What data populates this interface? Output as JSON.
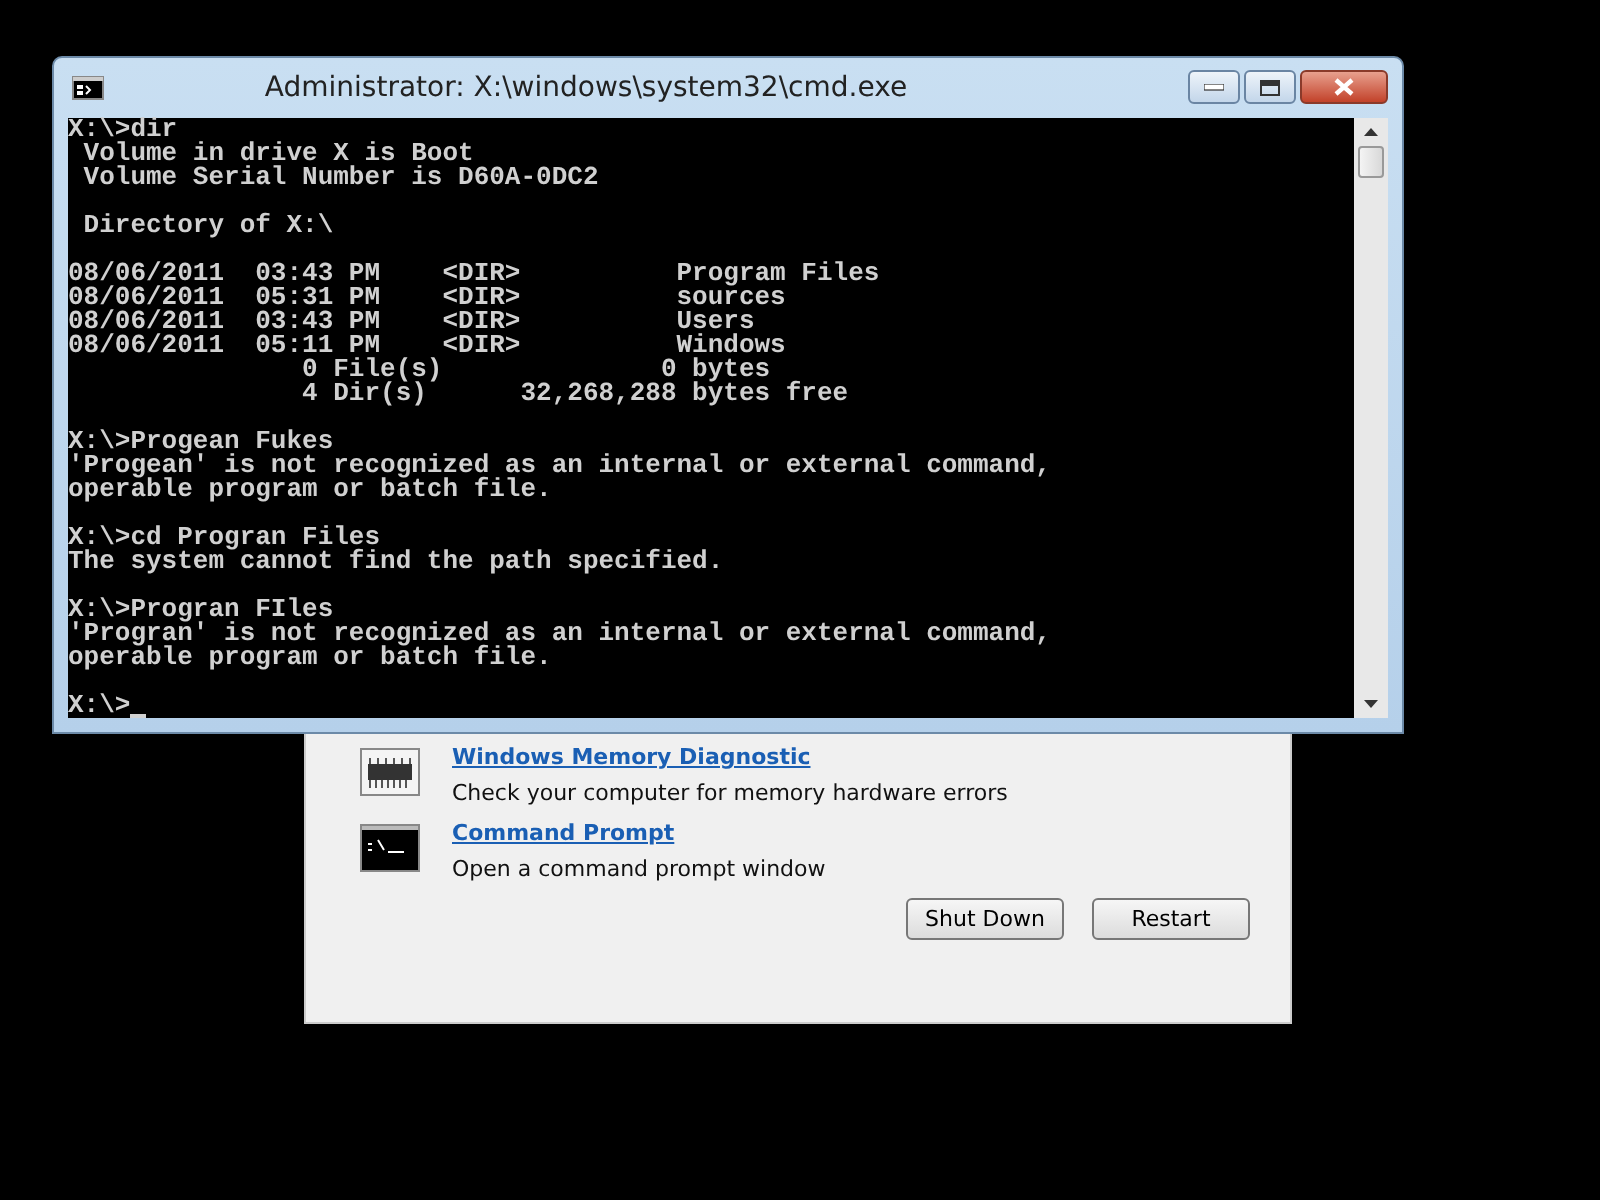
{
  "window": {
    "title": "Administrator: X:\\windows\\system32\\cmd.exe"
  },
  "console": {
    "blocks": [
      [
        "X:\\>dir",
        " Volume in drive X is Boot",
        " Volume Serial Number is D60A-0DC2"
      ],
      [
        " Directory of X:\\"
      ],
      [
        "08/06/2011  03:43 PM    <DIR>          Program Files",
        "08/06/2011  05:31 PM    <DIR>          sources",
        "08/06/2011  03:43 PM    <DIR>          Users",
        "08/06/2011  05:11 PM    <DIR>          Windows",
        "               0 File(s)              0 bytes",
        "               4 Dir(s)      32,268,288 bytes free"
      ],
      [
        "X:\\>Progean Fukes",
        "'Progean' is not recognized as an internal or external command,",
        "operable program or batch file."
      ],
      [
        "X:\\>cd Progran Files",
        "The system cannot find the path specified."
      ],
      [
        "X:\\>Progran FIles",
        "'Progran' is not recognized as an internal or external command,",
        "operable program or batch file."
      ]
    ],
    "prompt": "X:\\>"
  },
  "recovery_options": [
    {
      "kind": "memory",
      "title": "Windows Memory Diagnostic",
      "description": "Check your computer for memory hardware errors"
    },
    {
      "kind": "console",
      "title": "Command Prompt",
      "description": "Open a command prompt window"
    }
  ],
  "buttons": [
    "Shut Down",
    "Restart"
  ]
}
